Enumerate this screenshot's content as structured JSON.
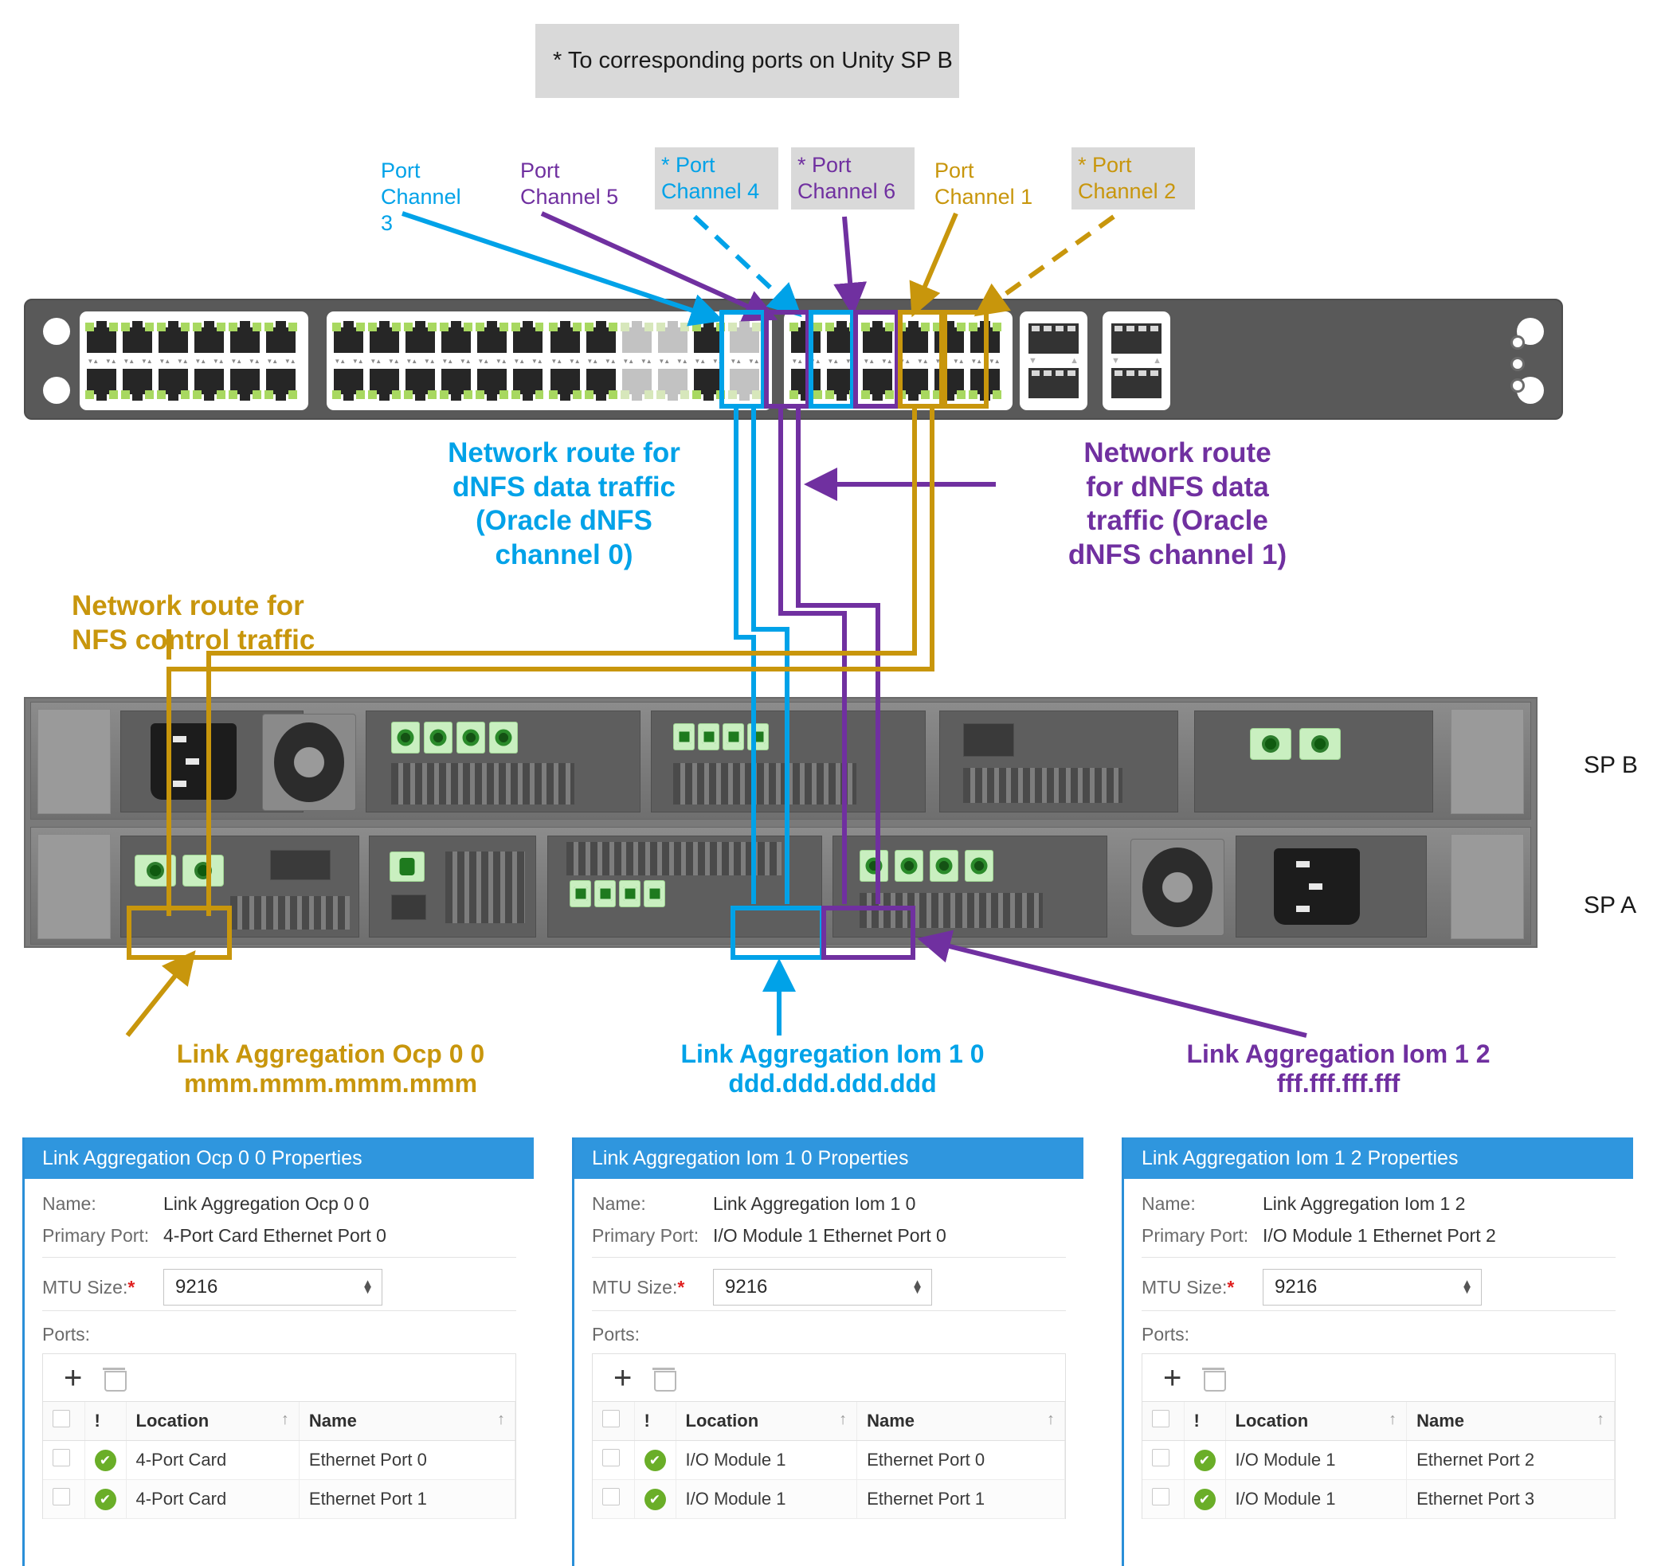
{
  "footnote": "* To corresponding ports on Unity SP B",
  "colors": {
    "cyan": "#00A2E8",
    "purple": "#7030A0",
    "gold": "#C8960C",
    "panel_blue": "#2f96de",
    "status_green": "#6aae28",
    "required_red": "#e02020",
    "shaded_bg": "#d9d9d9"
  },
  "port_channels": [
    {
      "id": "pc3",
      "text": "Port\nChannel 3",
      "color": "#00A2E8",
      "shaded": false
    },
    {
      "id": "pc5",
      "text": "Port\nChannel 5",
      "color": "#7030A0",
      "shaded": false
    },
    {
      "id": "pc4",
      "text": "* Port\nChannel 4",
      "color": "#00A2E8",
      "shaded": true
    },
    {
      "id": "pc6",
      "text": "* Port\nChannel 6",
      "color": "#7030A0",
      "shaded": true
    },
    {
      "id": "pc1",
      "text": "Port\nChannel 1",
      "color": "#C8960C",
      "shaded": false
    },
    {
      "id": "pc2",
      "text": "* Port\nChannel 2",
      "color": "#C8960C",
      "shaded": true
    }
  ],
  "routes": [
    {
      "id": "route-dnfs-0",
      "text": "Network route for\ndNFS data traffic\n(Oracle dNFS\nchannel 0)",
      "color": "#00A2E8"
    },
    {
      "id": "route-dnfs-1",
      "text": "Network route\nfor dNFS data\ntraffic (Oracle\ndNFS channel 1)",
      "color": "#7030A0"
    },
    {
      "id": "route-nfs-control",
      "text": "Network route for\nNFS control traffic",
      "color": "#C8960C"
    }
  ],
  "array": {
    "sp_b_label": "SP B",
    "sp_a_label": "SP A"
  },
  "link_aggregations": [
    {
      "caption": "Link Aggregation Ocp 0 0\nmmm.mmm.mmm.mmm",
      "color": "#C8960C"
    },
    {
      "caption": "Link Aggregation Iom 1 0\nddd.ddd.ddd.ddd",
      "color": "#00A2E8"
    },
    {
      "caption": "Link Aggregation Iom 1 2\nfff.fff.fff.fff",
      "color": "#7030A0"
    }
  ],
  "panels": [
    {
      "title": "Link Aggregation Ocp 0 0 Properties",
      "name_label": "Name:",
      "name_value": "Link Aggregation Ocp 0 0",
      "primary_label": "Primary Port:",
      "primary_value": "4-Port Card Ethernet Port 0",
      "mtu_label": "MTU Size:",
      "mtu_required": "*",
      "mtu_value": "9216",
      "ports_label": "Ports:",
      "add_icon": "plus-icon",
      "delete_icon": "trash-icon",
      "columns": [
        "",
        "!",
        "Location",
        "Name"
      ],
      "rows": [
        {
          "status": "ok",
          "location": "4-Port Card",
          "name": "Ethernet Port 0"
        },
        {
          "status": "ok",
          "location": "4-Port Card",
          "name": "Ethernet Port 1"
        }
      ]
    },
    {
      "title": "Link Aggregation Iom 1 0 Properties",
      "name_label": "Name:",
      "name_value": "Link Aggregation Iom 1 0",
      "primary_label": "Primary Port:",
      "primary_value": "I/O Module 1 Ethernet Port 0",
      "mtu_label": "MTU Size:",
      "mtu_required": "*",
      "mtu_value": "9216",
      "ports_label": "Ports:",
      "add_icon": "plus-icon",
      "delete_icon": "trash-icon",
      "columns": [
        "",
        "!",
        "Location",
        "Name"
      ],
      "rows": [
        {
          "status": "ok",
          "location": "I/O Module 1",
          "name": "Ethernet Port 0"
        },
        {
          "status": "ok",
          "location": "I/O Module 1",
          "name": "Ethernet Port 1"
        }
      ]
    },
    {
      "title": "Link Aggregation Iom 1 2 Properties",
      "name_label": "Name:",
      "name_value": "Link Aggregation Iom 1 2",
      "primary_label": "Primary Port:",
      "primary_value": "I/O Module 1 Ethernet Port 2",
      "mtu_label": "MTU Size:",
      "mtu_required": "*",
      "mtu_value": "9216",
      "ports_label": "Ports:",
      "add_icon": "plus-icon",
      "delete_icon": "trash-icon",
      "columns": [
        "",
        "!",
        "Location",
        "Name"
      ],
      "rows": [
        {
          "status": "ok",
          "location": "I/O Module 1",
          "name": "Ethernet Port 2"
        },
        {
          "status": "ok",
          "location": "I/O Module 1",
          "name": "Ethernet Port 3"
        }
      ]
    }
  ]
}
